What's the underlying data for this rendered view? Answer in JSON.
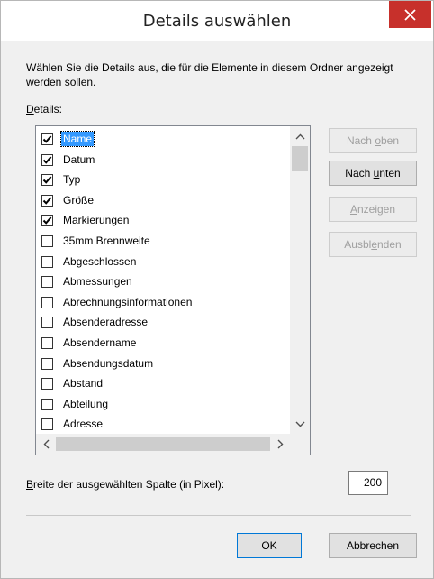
{
  "window": {
    "title": "Details auswählen"
  },
  "intro": "Wählen Sie die Details aus, die für die Elemente in diesem Ordner angezeigt werden sollen.",
  "details_label": {
    "mnemonic": "D",
    "rest": "etails:"
  },
  "items": [
    {
      "label": "Name",
      "checked": true,
      "selected": true
    },
    {
      "label": "Datum",
      "checked": true
    },
    {
      "label": "Typ",
      "checked": true
    },
    {
      "label": "Größe",
      "checked": true
    },
    {
      "label": "Markierungen",
      "checked": true
    },
    {
      "label": "35mm Brennweite",
      "checked": false
    },
    {
      "label": "Abgeschlossen",
      "checked": false
    },
    {
      "label": "Abmessungen",
      "checked": false
    },
    {
      "label": "Abrechnungsinformationen",
      "checked": false
    },
    {
      "label": "Absenderadresse",
      "checked": false
    },
    {
      "label": "Absendername",
      "checked": false
    },
    {
      "label": "Absendungsdatum",
      "checked": false
    },
    {
      "label": "Abstand",
      "checked": false
    },
    {
      "label": "Abteilung",
      "checked": false
    },
    {
      "label": "Adresse",
      "checked": false
    }
  ],
  "buttons": {
    "move_up": {
      "before": "Nach ",
      "mnemonic": "o",
      "after": "ben"
    },
    "move_down": {
      "before": "Nach ",
      "mnemonic": "u",
      "after": "nten"
    },
    "show": {
      "before": "",
      "mnemonic": "A",
      "after": "nzeigen"
    },
    "hide": {
      "before": "Ausbl",
      "mnemonic": "e",
      "after": "nden"
    },
    "ok": "OK",
    "cancel": "Abbrechen"
  },
  "width": {
    "label_mnemonic": "B",
    "label_rest": "reite der ausgewählten Spalte (in Pixel):",
    "value": "200"
  },
  "colors": {
    "close_bg": "#c7302b",
    "selection": "#3399ff",
    "default_border": "#0078d7"
  }
}
